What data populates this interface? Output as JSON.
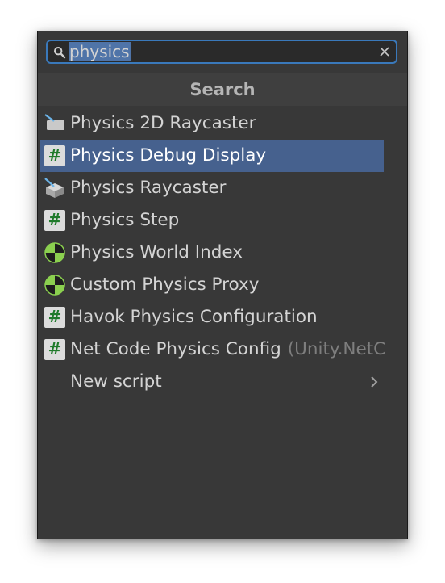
{
  "search": {
    "value": "physics"
  },
  "header": {
    "title": "Search"
  },
  "items": [
    {
      "label": "Physics 2D Raycaster",
      "namespace": "",
      "icon": "raycaster-2d-icon"
    },
    {
      "label": "Physics Debug Display",
      "namespace": "",
      "icon": "script-hash-icon"
    },
    {
      "label": "Physics Raycaster",
      "namespace": "",
      "icon": "raycaster-3d-icon"
    },
    {
      "label": "Physics Step",
      "namespace": "",
      "icon": "script-hash-icon"
    },
    {
      "label": "Physics World Index",
      "namespace": "",
      "icon": "physics-component-icon"
    },
    {
      "label": "Custom Physics Proxy",
      "namespace": "",
      "icon": "physics-component-icon"
    },
    {
      "label": "Havok Physics Configuration",
      "namespace": "",
      "icon": "script-hash-icon"
    },
    {
      "label": "Net Code Physics Config",
      "namespace": "(Unity.NetC",
      "icon": "script-hash-icon"
    }
  ],
  "new_script": {
    "label": "New script"
  },
  "colors": {
    "panel_bg": "#383838",
    "selection": "#46618e",
    "search_border": "#3a79bb",
    "text_highlight": "#4f74a8",
    "hash_green": "#1f7a2a",
    "physics_green": "#8bd04f"
  }
}
